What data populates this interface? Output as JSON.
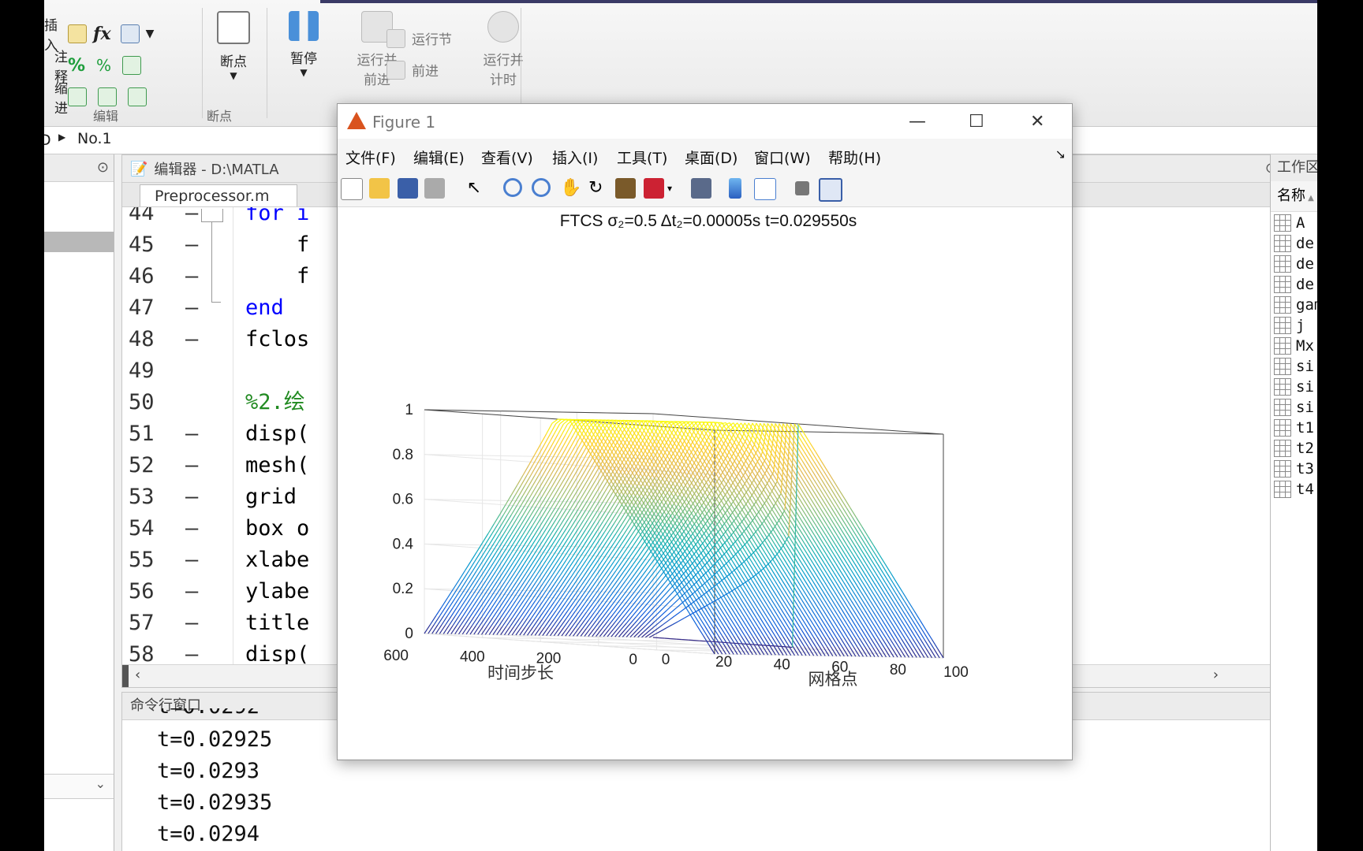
{
  "ribbon": {
    "edit_rows": [
      "插入",
      "注释",
      "缩进"
    ],
    "edit_group": "编辑",
    "breakpoint_group": "断点",
    "breakpoint_btn": "断点",
    "pause_btn": "暂停",
    "run_advance_1": "运行并",
    "run_advance_2": "前进",
    "run_section": "运行节",
    "advance": "前进",
    "run_time_1": "运行并",
    "run_time_2": "计时"
  },
  "address": {
    "crumb": "No.1"
  },
  "editor": {
    "header": "编辑器 - D:\\MATLA",
    "tab": "Preprocessor.m",
    "lines": [
      {
        "n": "44",
        "dash": "–",
        "code": "for i"
      },
      {
        "n": "45",
        "dash": "–",
        "code": "    f"
      },
      {
        "n": "46",
        "dash": "–",
        "code": "    f"
      },
      {
        "n": "47",
        "dash": "–",
        "code": "end"
      },
      {
        "n": "48",
        "dash": "–",
        "code": "fclos"
      },
      {
        "n": "49",
        "dash": "",
        "code": ""
      },
      {
        "n": "50",
        "dash": "",
        "code": "%2.绘"
      },
      {
        "n": "51",
        "dash": "–",
        "code": "disp("
      },
      {
        "n": "52",
        "dash": "–",
        "code": "mesh("
      },
      {
        "n": "53",
        "dash": "–",
        "code": "grid "
      },
      {
        "n": "54",
        "dash": "–",
        "code": "box o"
      },
      {
        "n": "55",
        "dash": "–",
        "code": "xlabe"
      },
      {
        "n": "56",
        "dash": "–",
        "code": "ylabe"
      },
      {
        "n": "57",
        "dash": "–",
        "code": "title"
      },
      {
        "n": "58",
        "dash": "–",
        "code": "disp("
      }
    ]
  },
  "command": {
    "title": "命令行窗口",
    "lines": [
      "t=0.0292",
      "t=0.02925",
      "t=0.0293",
      "t=0.02935",
      "t=0.0294"
    ]
  },
  "workspace": {
    "title": "工作区",
    "col": "名称",
    "vars": [
      "A",
      "de",
      "de",
      "de",
      "gam",
      "j",
      "Mx",
      "si",
      "si",
      "si",
      "t1",
      "t2",
      "t3",
      "t4"
    ]
  },
  "figure": {
    "title": "Figure 1",
    "menu": [
      "文件(F)",
      "编辑(E)",
      "查看(V)",
      "插入(I)",
      "工具(T)",
      "桌面(D)",
      "窗口(W)",
      "帮助(H)"
    ],
    "plot_title": "FTCS    σ₂=0.5     Δt₂=0.00005s     t=0.029550s"
  },
  "chart_data": {
    "type": "surface",
    "title": "FTCS    σ₂=0.5     Δt₂=0.00005s     t=0.029550s",
    "xlabel": "网格点",
    "ylabel": "时间步长",
    "xlim": [
      0,
      100
    ],
    "ylim": [
      0,
      600
    ],
    "zlim": [
      0,
      1
    ],
    "xticks": [
      "0",
      "20",
      "40",
      "60",
      "80",
      "100"
    ],
    "yticks": [
      "0",
      "200",
      "400",
      "600"
    ],
    "zticks": [
      "0",
      "0.2",
      "0.4",
      "0.6",
      "0.8",
      "1"
    ],
    "description_series": [
      {
        "name": "initial profile (time step 0)",
        "x": [
          0,
          50,
          50,
          100
        ],
        "z": [
          0,
          0,
          1,
          0
        ]
      },
      {
        "name": "final profile (time step 600)",
        "x": [
          0,
          50,
          100
        ],
        "z": [
          0,
          1,
          0
        ]
      }
    ],
    "colormap": "parula",
    "grid": true
  }
}
